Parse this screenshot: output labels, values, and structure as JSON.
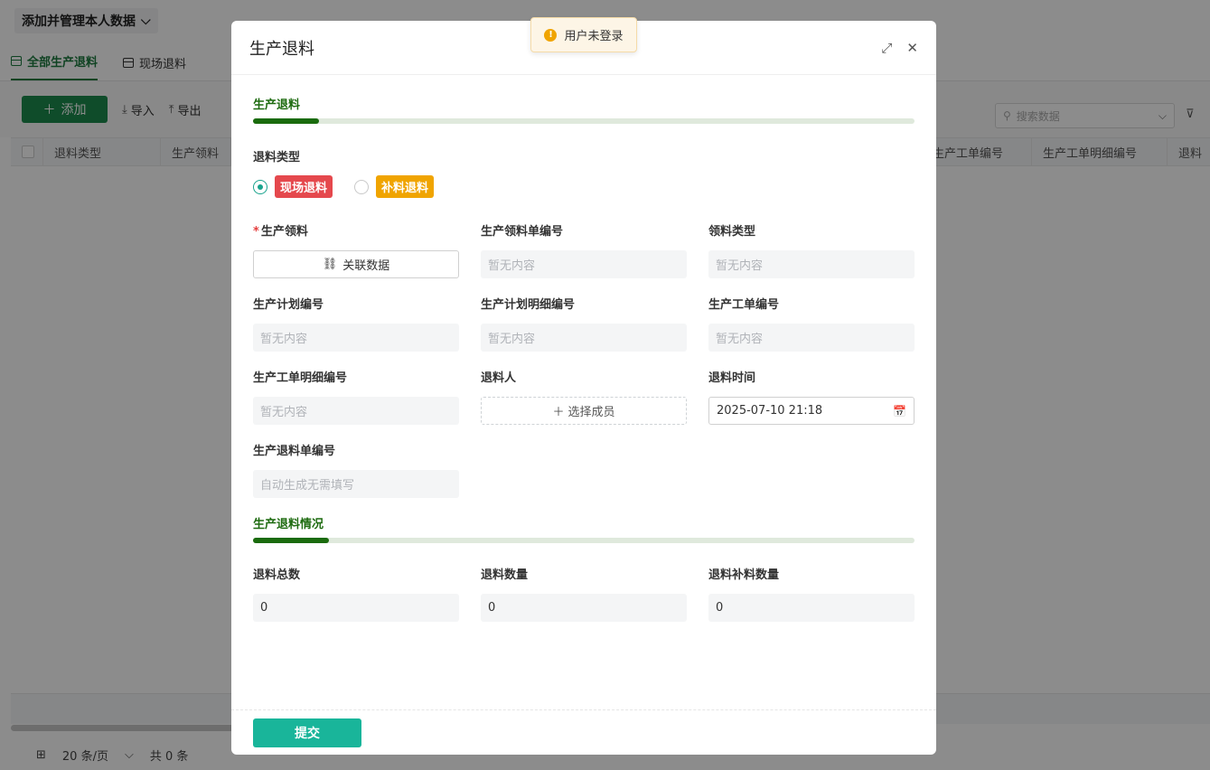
{
  "background": {
    "view_name": "添加并管理本人数据",
    "tabs": [
      {
        "label": "全部生产退料",
        "active": true
      },
      {
        "label": "现场退料",
        "active": false
      }
    ],
    "toolbar": {
      "add_label": "添加",
      "import_label": "导入",
      "export_label": "导出",
      "search_placeholder": "搜索数据"
    },
    "grid_columns": [
      "退料类型",
      "生产领料",
      "生产工单编号",
      "生产工单明细编号",
      "退料"
    ],
    "pager": {
      "page_size": "20 条/页",
      "total": "共 0 条"
    }
  },
  "toast": {
    "message": "用户未登录"
  },
  "modal": {
    "title": "生产退料",
    "section1": {
      "title": "生产退料",
      "progress": 0.1
    },
    "return_type": {
      "label": "退料类型",
      "options": [
        {
          "label": "现场退料",
          "selected": true,
          "color": "#e5484d"
        },
        {
          "label": "补料退料",
          "selected": false,
          "color": "#f0a400"
        }
      ]
    },
    "fields": {
      "production_pick": {
        "label": "生产领料",
        "button": "关联数据",
        "required": true
      },
      "pick_no": {
        "label": "生产领料单编号",
        "value": "暂无内容"
      },
      "pick_type": {
        "label": "领料类型",
        "value": "暂无内容"
      },
      "plan_no": {
        "label": "生产计划编号",
        "value": "暂无内容"
      },
      "plan_detail_no": {
        "label": "生产计划明细编号",
        "value": "暂无内容"
      },
      "work_order_no": {
        "label": "生产工单编号",
        "value": "暂无内容"
      },
      "work_order_detail_no": {
        "label": "生产工单明细编号",
        "value": "暂无内容"
      },
      "returner": {
        "label": "退料人",
        "button": "选择成员"
      },
      "return_time": {
        "label": "退料时间",
        "value": "2025-07-10 21:18"
      },
      "return_no": {
        "label": "生产退料单编号",
        "placeholder": "自动生成无需填写"
      }
    },
    "section2": {
      "title": "生产退料情况",
      "progress": 0.115
    },
    "quantities": {
      "total": {
        "label": "退料总数",
        "value": "0"
      },
      "qty": {
        "label": "退料数量",
        "value": "0"
      },
      "supplement_qty": {
        "label": "退料补料数量",
        "value": "0"
      }
    },
    "submit_label": "提交"
  }
}
